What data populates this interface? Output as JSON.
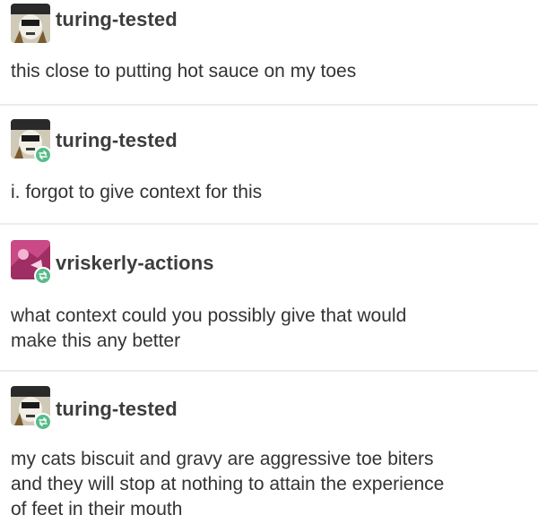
{
  "posts": [
    {
      "username": "turing-tested",
      "text": "this close to putting hot sauce on my toes",
      "avatar": "skull-avatar-icon",
      "reblog": false
    },
    {
      "username": "turing-tested",
      "text": "i. forgot to give context for this",
      "avatar": "skull-avatar-icon",
      "reblog": true
    },
    {
      "username": "vriskerly-actions",
      "text_lines": [
        "what context could you possibly give that would",
        "make this any better"
      ],
      "avatar": "pink-character-avatar-icon",
      "reblog": true
    },
    {
      "username": "turing-tested",
      "text_lines": [
        "my cats biscuit and gravy are aggressive toe biters",
        "and they will stop at nothing to attain the experience",
        "of feet in their mouth"
      ],
      "avatar": "skull-avatar-icon",
      "reblog": true
    }
  ],
  "colors": {
    "reblog_badge": "#56bc8a",
    "divider": "#ececec",
    "text": "#333333"
  }
}
